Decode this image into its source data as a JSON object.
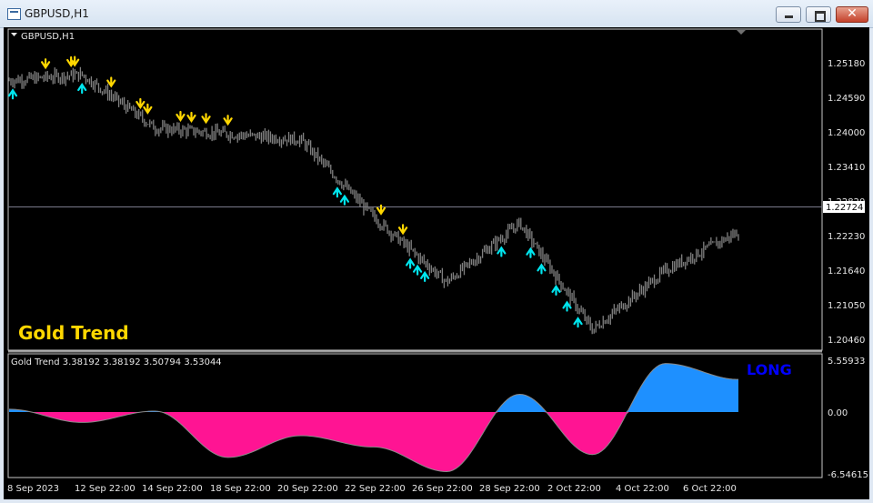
{
  "window": {
    "title": "GBPUSD,H1"
  },
  "chart_header": {
    "symbol": "GBPUSD,H1"
  },
  "price_axis": {
    "ticks": [
      "1.25180",
      "1.24590",
      "1.24000",
      "1.23410",
      "1.22820",
      "1.22230",
      "1.21640",
      "1.21050",
      "1.20460"
    ],
    "current_price": "1.22724"
  },
  "indicator": {
    "name": "Gold Trend",
    "label": "Gold Trend",
    "header": "Gold Trend  3.38192 3.38192 3.50794 3.53044",
    "signal": "LONG",
    "axis_ticks": [
      "5.55933",
      "0.00",
      "-6.54615"
    ]
  },
  "time_axis": {
    "labels": [
      "8 Sep 2023",
      "12 Sep 22:00",
      "14 Sep 22:00",
      "18 Sep 22:00",
      "20 Sep 22:00",
      "22 Sep 22:00",
      "26 Sep 22:00",
      "28 Sep 22:00",
      "2 Oct 22:00",
      "4 Oct 22:00",
      "6 Oct 22:00"
    ]
  },
  "colors": {
    "background": "#000000",
    "candles": "#808080",
    "sell_arrow": "#ffd700",
    "buy_arrow": "#00e5ee",
    "bull_histogram": "#1e90ff",
    "bear_histogram": "#ff1493",
    "signal_text": "#0000ff"
  },
  "chart_data": [
    {
      "type": "line",
      "title": "GBPUSD,H1",
      "x": [
        "8 Sep 2023",
        "12 Sep 22:00",
        "14 Sep 22:00",
        "18 Sep 22:00",
        "20 Sep 22:00",
        "22 Sep 22:00",
        "26 Sep 22:00",
        "28 Sep 22:00",
        "2 Oct 22:00",
        "4 Oct 22:00",
        "6 Oct 22:00"
      ],
      "series": [
        {
          "values": [
            1.2485,
            1.2495,
            1.2405,
            1.2395,
            1.2385,
            1.2255,
            1.2145,
            1.2245,
            1.2065,
            1.2165,
            1.223
          ]
        }
      ],
      "ylim": [
        1.2046,
        1.2518
      ],
      "sell_arrows_x": [
        1.0,
        1.7,
        1.8,
        2.8,
        3.6,
        3.8,
        4.7,
        5.0,
        5.4,
        6.0,
        10.2,
        10.8
      ],
      "buy_arrows_x": [
        0.1,
        2.0,
        9.0,
        9.2,
        11.0,
        11.2,
        11.4,
        13.5,
        14.3,
        14.6,
        15.0,
        15.3,
        15.6
      ]
    },
    {
      "type": "area",
      "title": "Gold Trend",
      "x": [
        "8 Sep 2023",
        "12 Sep 22:00",
        "14 Sep 22:00",
        "18 Sep 22:00",
        "20 Sep 22:00",
        "22 Sep 22:00",
        "26 Sep 22:00",
        "28 Sep 22:00",
        "2 Oct 22:00",
        "4 Oct 22:00",
        "6 Oct 22:00"
      ],
      "series": [
        {
          "name": "Gold Trend",
          "values": [
            0.3,
            -1.1,
            0.1,
            -4.8,
            -2.5,
            -3.7,
            -6.3,
            1.9,
            -4.5,
            5.2,
            3.5
          ]
        }
      ],
      "ylim": [
        -6.54615,
        5.55933
      ]
    }
  ]
}
